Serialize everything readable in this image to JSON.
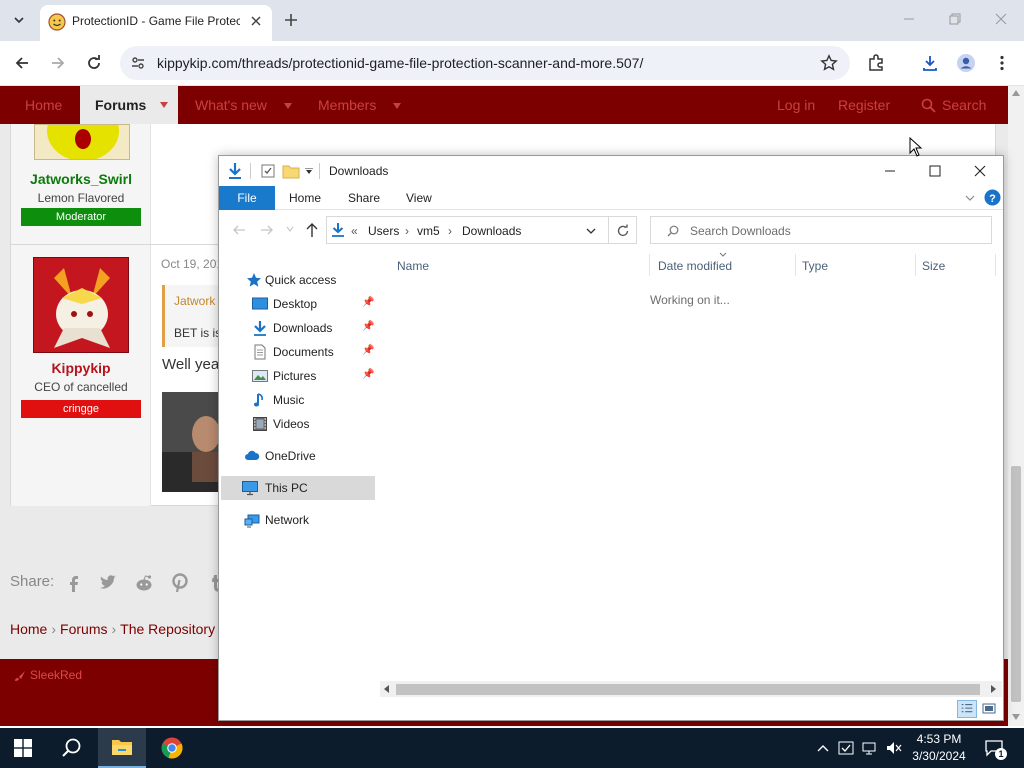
{
  "browser": {
    "tab_title": "ProtectionID - Game File Protec",
    "url": "kippykip.com/threads/protectionid-game-file-protection-scanner-and-more.507/"
  },
  "site": {
    "nav": {
      "home": "Home",
      "forums": "Forums",
      "whats_new": "What's new",
      "members": "Members",
      "login": "Log in",
      "register": "Register",
      "search": "Search"
    },
    "post1": {
      "username": "Jatworks_Swirl",
      "user_title": "Lemon Flavored",
      "badge": "Moderator",
      "badge_color": "#0d8f0d"
    },
    "post2": {
      "username": "Kippykip",
      "user_title": "CEO of cancelled",
      "badge": "cringge",
      "badge_color": "#e01010",
      "date": "Oct 19, 201",
      "quote_author": "Jatwork",
      "quote_text": "BET is is",
      "text": "Well yea"
    },
    "share_label": "Share:",
    "breadcrumbs": [
      "Home",
      "Forums",
      "The Repository"
    ],
    "footer_brand": "SleekRed"
  },
  "explorer": {
    "title": "Downloads",
    "ribbon_tabs": [
      "File",
      "Home",
      "Share",
      "View"
    ],
    "address": [
      "Users",
      "vm5",
      "Downloads"
    ],
    "search_placeholder": "Search Downloads",
    "nav_items": [
      {
        "label": "Quick access",
        "icon": "star-icon"
      },
      {
        "label": "Desktop",
        "icon": "desktop-icon",
        "pinned": true
      },
      {
        "label": "Downloads",
        "icon": "download-icon",
        "pinned": true
      },
      {
        "label": "Documents",
        "icon": "document-icon",
        "pinned": true
      },
      {
        "label": "Pictures",
        "icon": "pictures-icon",
        "pinned": true
      },
      {
        "label": "Music",
        "icon": "music-icon"
      },
      {
        "label": "Videos",
        "icon": "videos-icon"
      },
      {
        "label": "OneDrive",
        "icon": "cloud-icon"
      },
      {
        "label": "This PC",
        "icon": "computer-icon",
        "selected": true
      },
      {
        "label": "Network",
        "icon": "network-icon"
      }
    ],
    "columns": [
      "Name",
      "Date modified",
      "Type",
      "Size"
    ],
    "status_message": "Working on it..."
  },
  "taskbar": {
    "time": "4:53 PM",
    "date": "3/30/2024",
    "notification_count": "1"
  }
}
